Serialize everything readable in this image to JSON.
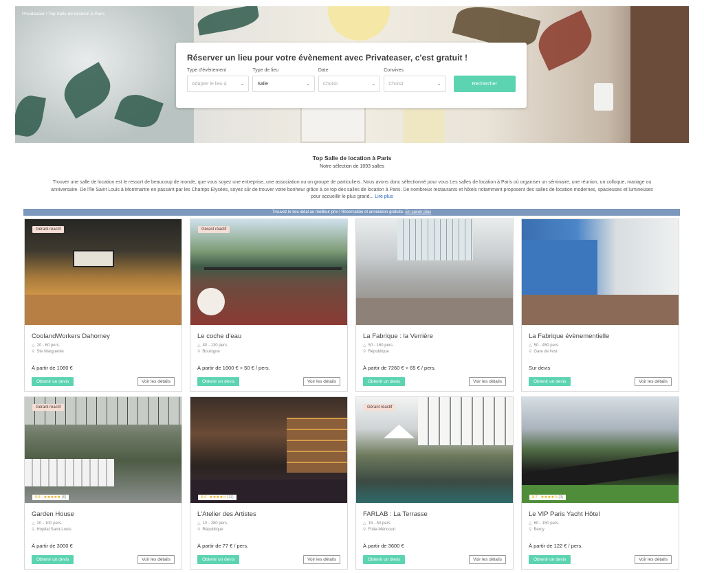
{
  "hero": {
    "breadcrumb": [
      "Privateaser",
      "Top Salle de location à Paris"
    ],
    "search": {
      "title": "Réserver un lieu pour votre évènement avec Privateaser, c'est gratuit !",
      "fields": [
        {
          "label": "Type d'évènement",
          "value": "",
          "placeholder": "Adapter le lieu à"
        },
        {
          "label": "Type de lieu",
          "value": "Salle",
          "placeholder": ""
        },
        {
          "label": "Date",
          "value": "",
          "placeholder": "Choisir"
        },
        {
          "label": "Convives",
          "value": "",
          "placeholder": "Choisir"
        }
      ],
      "button": "Rechercher"
    }
  },
  "intro": {
    "title": "Top Salle de location à Paris",
    "subtitle": "Notre sélection de 1093 salles",
    "description": "Trouver une salle de location est le ressort de beaucoup de monde, que vous soyez une entreprise, une association ou un groupe de particuliers. Nous avons donc sélectionné pour vous Les salles de location à Paris où organiser un séminaire, une réunion, un colloque, mariage ou anniversaire. De l'île Saint Louis à Montmartre en passant par les Champs Elysées, soyez sûr de trouver votre bonheur grâce à ce top des salles de location à Paris. De nombreux restaurants et hôtels notamment proposent des salles de location modernes, spacieuses et lumineuses pour accueillir le plus grand...",
    "read_more": "Lire plus"
  },
  "banner": {
    "text": "Trouvez le lieu idéal au meilleur prix ! Réservation et annulation gratuite.",
    "link": "En savoir plus"
  },
  "labels": {
    "cta": "Obtenir un devis",
    "details": "Voir les détails",
    "badge": "Gérant réactif"
  },
  "venues": [
    {
      "name": "CoolandWorkers Dahomey",
      "capacity": "20 - 60 pers.",
      "location": "Ste Marguerite",
      "price": "À partir de 1080 €",
      "badge": true,
      "rating": ""
    },
    {
      "name": "Le coche d'eau",
      "capacity": "40 - 130 pers.",
      "location": "Boulogne",
      "price": "À partir de 1600 € + 50 € / pers.",
      "badge": true,
      "rating": ""
    },
    {
      "name": "La Fabrique : la Verrière",
      "capacity": "50 - 160 pers.",
      "location": "République",
      "price": "À partir de 7260 € + 65 € / pers.",
      "badge": false,
      "rating": ""
    },
    {
      "name": "La Fabrique évènementielle",
      "capacity": "50 - 450 pers.",
      "location": "Gare de l'est",
      "price": "Sur devis",
      "badge": false,
      "rating": ""
    },
    {
      "name": "Garden House",
      "capacity": "20 - 100 pers.",
      "location": "Hopital Saint-Louis",
      "price": "À partir de 3000 €",
      "badge": true,
      "rating": "9.8",
      "rating_count": "(6)",
      "stars": "★★★★★"
    },
    {
      "name": "L'Atelier des Artistes",
      "capacity": "10 - 280 pers.",
      "location": "République",
      "price": "À partir de 77 € / pers.",
      "badge": false,
      "rating": "8.4",
      "rating_count": "(11)",
      "stars": "★★★★½"
    },
    {
      "name": "FARLAB : La Terrasse",
      "capacity": "15 - 50 pers.",
      "location": "Folie-Méricourt",
      "price": "À partir de 3600 €",
      "badge": true,
      "rating": ""
    },
    {
      "name": "Le VIP Paris Yacht Hôtel",
      "capacity": "60 - 150 pers.",
      "location": "Bercy",
      "price": "À partir de 122 € / pers.",
      "badge": false,
      "rating": "8.7",
      "rating_count": "(3)",
      "stars": "★★★★½"
    }
  ]
}
